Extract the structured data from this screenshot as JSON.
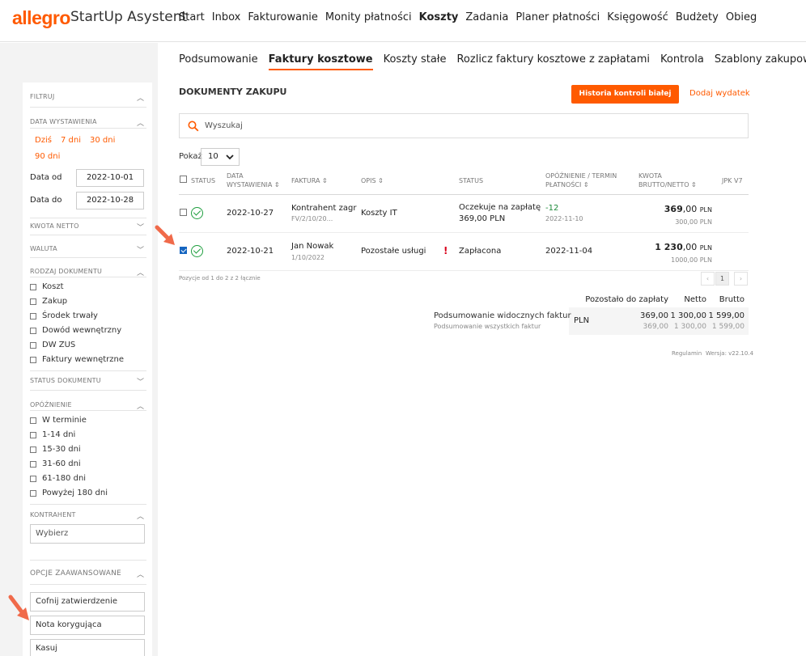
{
  "header": {
    "logo": "allegro",
    "app_name": "StartUp Asystent",
    "nav": [
      "Start",
      "Inbox",
      "Fakturowanie",
      "Monity płatności",
      "Koszty",
      "Zadania",
      "Planer płatności",
      "Księgowość",
      "Budżety",
      "Obieg"
    ],
    "active_nav": "Koszty"
  },
  "subnav": {
    "tabs": [
      "Podsumowanie",
      "Faktury kosztowe",
      "Koszty stałe",
      "Rozlicz faktury kosztowe z zapłatami",
      "Kontrola",
      "Szablony zakupowe"
    ],
    "active": "Faktury kosztowe"
  },
  "sidebar": {
    "filter_title": "FILTRUJ",
    "date_section": "DATA WYSTAWIENIA",
    "quick_dates": [
      "Dziś",
      "7 dni",
      "30 dni",
      "90 dni"
    ],
    "date_from_label": "Data od",
    "date_from": "2022-10-01",
    "date_to_label": "Data do",
    "date_to": "2022-10-28",
    "amount_section": "KWOTA NETTO",
    "currency_section": "WALUTA",
    "doctype_section": "RODZAJ DOKUMENTU",
    "doctypes": [
      "Koszt",
      "Zakup",
      "Środek trwały",
      "Dowód wewnętrzny",
      "DW ZUS",
      "Faktury wewnętrzne"
    ],
    "status_section": "STATUS DOKUMENTU",
    "delay_section": "OPÓŹNIENIE",
    "delays": [
      "W terminie",
      "1-14 dni",
      "15-30 dni",
      "31-60 dni",
      "61-180 dni",
      "Powyżej 180 dni"
    ],
    "contractor_section": "KONTRAHENT",
    "contractor_placeholder": "Wybierz",
    "advanced_section": "OPCJE ZAAWANSOWANE",
    "advanced_buttons": [
      "Cofnij zatwierdzenie",
      "Nota korygująca",
      "Kasuj"
    ]
  },
  "main": {
    "title": "DOKUMENTY ZAKUPU",
    "history_button": "Historia kontroli białej listy",
    "add_expense": "Dodaj wydatek",
    "search_placeholder": "Wyszukaj",
    "show_label": "Pokaż",
    "show_value": "10",
    "columns": {
      "status": "STATUS",
      "date_l1": "DATA",
      "date_l2": "WYSTAWIENIA",
      "invoice": "FAKTURA",
      "desc": "OPIS",
      "state": "STATUS",
      "delay_l1": "OPÓŹNIENIE / TERMIN",
      "delay_l2": "PŁATNOŚCI",
      "amount_l1": "KWOTA",
      "amount_l2": "BRUTTO/NETTO",
      "jpk": "JPK V7"
    },
    "rows": [
      {
        "date": "2022-10-27",
        "contractor": "Kontrahent zagr",
        "invoice_no": "FV/2/10/20...",
        "desc": "Koszty IT",
        "state": "Oczekuje na zapłatę",
        "state_sub": "369,00 PLN",
        "delay": "-12",
        "due": "2022-11-10",
        "gross_int": "369",
        "gross_dec": ",00",
        "currency": "PLN",
        "net": "300,00 PLN",
        "checked": false
      },
      {
        "date": "2022-10-21",
        "contractor": "Jan Nowak",
        "invoice_no": "1/10/2022",
        "desc": "Pozostałe usługi",
        "warning": "!",
        "state": "Zapłacona",
        "due": "2022-11-04",
        "gross_int": "1 230",
        "gross_dec": ",00",
        "currency": "PLN",
        "net": "1000,00 PLN",
        "checked": true
      }
    ],
    "pagination_info": "Pozycje od 1 do 2 z 2 łącznie",
    "pages": [
      "‹",
      "1",
      "›"
    ],
    "summary": {
      "visible_label": "Podsumowanie widocznych faktur",
      "all_label": "Podsumowanie wszystkich faktur",
      "col_remaining": "Pozostało do zapłaty",
      "col_net": "Netto",
      "col_gross": "Brutto",
      "currency": "PLN",
      "visible": {
        "remaining": "369,00",
        "net": "1 300,00",
        "gross": "1 599,00"
      },
      "all": {
        "remaining": "369,00",
        "net": "1 300,00",
        "gross": "1 599,00"
      }
    },
    "footer_terms": "Regulamin",
    "footer_version": "Wersja: v22.10.4"
  }
}
